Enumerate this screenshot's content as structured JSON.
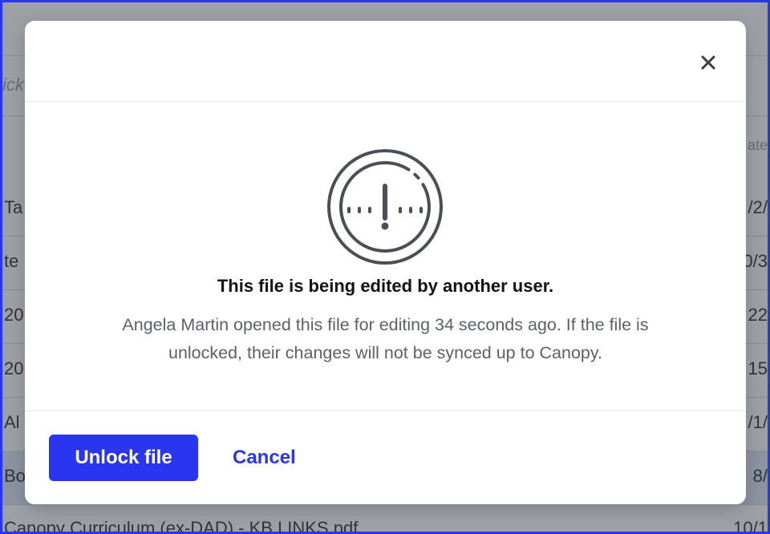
{
  "background": {
    "search_placeholder": "ick",
    "date_header": "ate",
    "rows": [
      {
        "left": "Ta",
        "right": "/2/"
      },
      {
        "left": "te",
        "right": "0/3"
      },
      {
        "left": "20",
        "right": "22"
      },
      {
        "left": "20",
        "right": "15"
      },
      {
        "left": "Al",
        "right": "/1/"
      },
      {
        "left": "Bo",
        "right": "8/"
      },
      {
        "left": "Canopy Curriculum (ex-DAD) - KB LINKS.pdf",
        "right": "10/1"
      }
    ]
  },
  "modal": {
    "close_icon": "close-icon",
    "warning_icon": "exclamation-gauge-icon",
    "title": "This file is being edited by another user.",
    "message": "Angela Martin opened this file for editing 34 seconds ago. If the file is unlocked, their changes will not be synced up to Canopy.",
    "primary_button": "Unlock file",
    "secondary_button": "Cancel"
  },
  "colors": {
    "accent": "#2a35f0",
    "icon": "#4a4f57",
    "title": "#111317",
    "message": "#5c6168"
  }
}
